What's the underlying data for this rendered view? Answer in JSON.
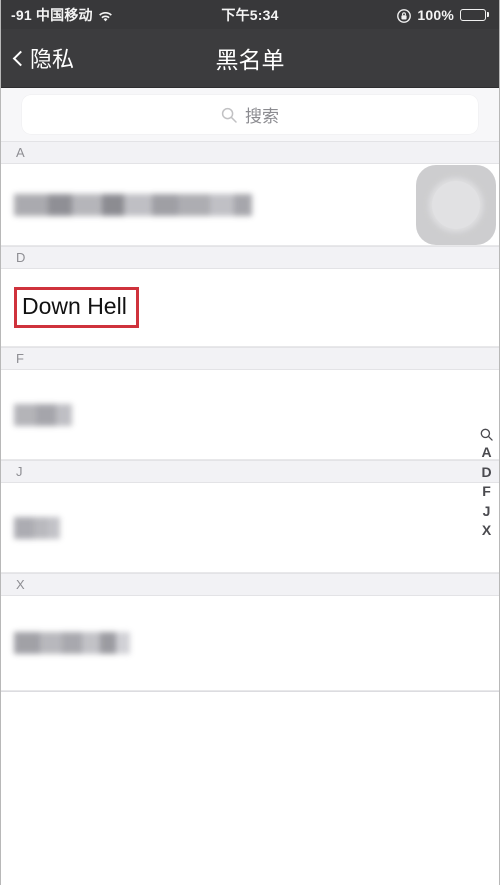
{
  "status_bar": {
    "carrier": "-91 中国移动",
    "wifi_icon": "wifi-icon",
    "time": "下午5:34",
    "rotation_lock_icon": "rotation-lock-icon",
    "battery_percent": "100%",
    "battery_icon": "battery-full-icon"
  },
  "nav_bar": {
    "back_icon": "chevron-left-icon",
    "back_label": "隐私",
    "title": "黑名单",
    "background_color": "#3c3c3e",
    "text_color": "#ffffff"
  },
  "search": {
    "icon": "search-icon",
    "placeholder": "搜索",
    "value": ""
  },
  "list": {
    "sections": [
      {
        "letter": "A",
        "rows": [
          {
            "name": "",
            "redacted": true
          }
        ]
      },
      {
        "letter": "D",
        "rows": [
          {
            "name": "Down Hell",
            "redacted": false,
            "highlighted": true
          }
        ]
      },
      {
        "letter": "F",
        "rows": [
          {
            "name": "",
            "redacted": true
          }
        ]
      },
      {
        "letter": "J",
        "rows": [
          {
            "name": "",
            "redacted": true
          }
        ]
      },
      {
        "letter": "X",
        "rows": [
          {
            "name": "",
            "redacted": true
          }
        ]
      }
    ]
  },
  "index_bar": {
    "search_icon": "search-icon",
    "letters": [
      "A",
      "D",
      "F",
      "J",
      "X"
    ]
  },
  "assistive_touch": {
    "icon": "assistive-touch-icon"
  },
  "highlight": {
    "color": "#cf323c"
  }
}
